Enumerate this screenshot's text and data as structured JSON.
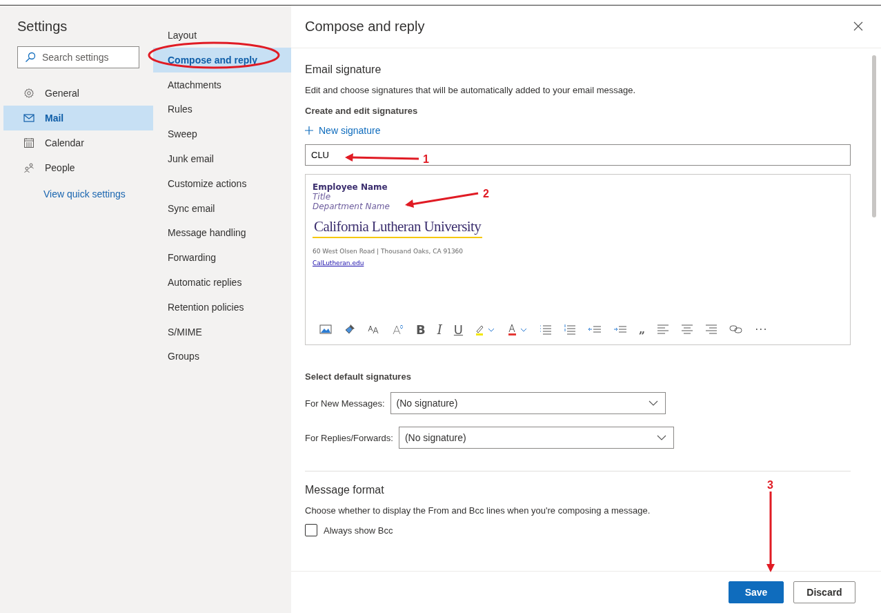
{
  "settings_nav": {
    "title": "Settings",
    "search": {
      "placeholder": "Search settings"
    },
    "items": [
      {
        "label": "General",
        "selected": false
      },
      {
        "label": "Mail",
        "selected": true
      },
      {
        "label": "Calendar",
        "selected": false
      },
      {
        "label": "People",
        "selected": false
      }
    ],
    "link": "View quick settings"
  },
  "sub_nav": {
    "items": [
      {
        "label": "Layout",
        "selected": false
      },
      {
        "label": "Compose and reply",
        "selected": true
      },
      {
        "label": "Attachments",
        "selected": false
      },
      {
        "label": "Rules",
        "selected": false
      },
      {
        "label": "Sweep",
        "selected": false
      },
      {
        "label": "Junk email",
        "selected": false
      },
      {
        "label": "Customize actions",
        "selected": false
      },
      {
        "label": "Sync email",
        "selected": false
      },
      {
        "label": "Message handling",
        "selected": false
      },
      {
        "label": "Forwarding",
        "selected": false
      },
      {
        "label": "Automatic replies",
        "selected": false
      },
      {
        "label": "Retention policies",
        "selected": false
      },
      {
        "label": "S/MIME",
        "selected": false
      },
      {
        "label": "Groups",
        "selected": false
      }
    ]
  },
  "panel": {
    "title": "Compose and reply",
    "email_signature": {
      "heading": "Email signature",
      "description": "Edit and choose signatures that will be automatically added to your email message.",
      "subheading": "Create and edit signatures",
      "new_button": "New signature",
      "name_value": "CLU",
      "body": {
        "name": "Employee Name",
        "title": "Title",
        "department": "Department Name",
        "logo": "California Lutheran University",
        "address": "60 West Olsen Road  | Thousand Oaks, CA 91360",
        "link": "CalLutheran.edu"
      },
      "toolbar": [
        {
          "kind": "picture"
        },
        {
          "kind": "brush"
        },
        {
          "kind": "fontsize"
        },
        {
          "kind": "grow"
        },
        {
          "kind": "bold",
          "label": "B"
        },
        {
          "kind": "italic",
          "label": "I"
        },
        {
          "kind": "underline",
          "label": "U"
        },
        {
          "kind": "highlight"
        },
        {
          "kind": "fontcolor"
        },
        {
          "kind": "bullets"
        },
        {
          "kind": "numbers"
        },
        {
          "kind": "outdent"
        },
        {
          "kind": "indent"
        },
        {
          "kind": "quote",
          "label": "„"
        },
        {
          "kind": "alignleft"
        },
        {
          "kind": "aligncenter"
        },
        {
          "kind": "alignright"
        },
        {
          "kind": "link"
        },
        {
          "kind": "more",
          "label": "···"
        }
      ]
    },
    "default_signatures": {
      "heading": "Select default signatures",
      "rows": [
        {
          "label": "For New Messages:",
          "value": "(No signature)"
        },
        {
          "label": "For Replies/Forwards:",
          "value": "(No signature)"
        }
      ]
    },
    "message_format": {
      "heading": "Message format",
      "description": "Choose whether to display the From and Bcc lines when you're composing a message.",
      "options": [
        {
          "label": "Always show Bcc",
          "checked": false
        }
      ]
    },
    "buttons": [
      {
        "label": "Save",
        "kind": "primary"
      },
      {
        "label": "Discard",
        "kind": "secondary"
      }
    ]
  },
  "annotations": [
    {
      "kind": "ellipse"
    },
    {
      "kind": "arrow",
      "number": "1"
    },
    {
      "kind": "arrow",
      "number": "2"
    },
    {
      "kind": "arrow",
      "number": "3"
    }
  ]
}
